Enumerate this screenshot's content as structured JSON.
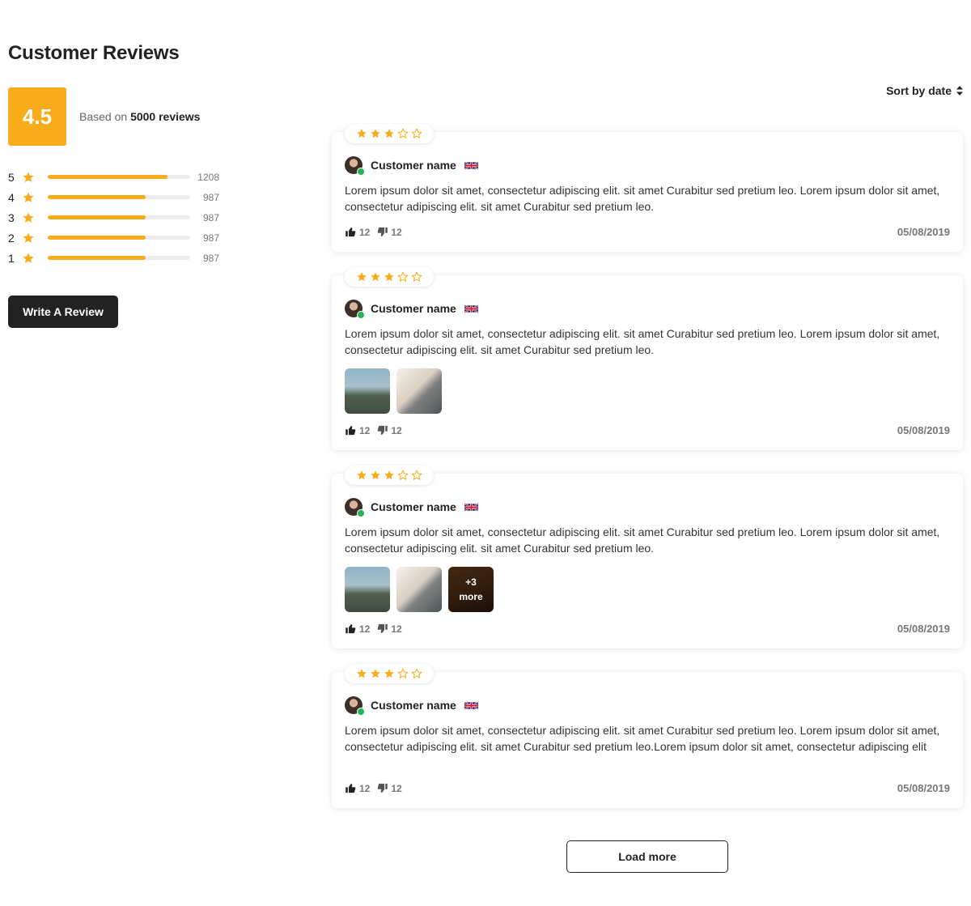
{
  "page": {
    "title": "Customer Reviews"
  },
  "summary": {
    "score": "4.5",
    "based_on_prefix": "Based on",
    "based_on_count": "5000 reviews",
    "distribution": [
      {
        "stars": "5",
        "count": "1208",
        "fraction": 0.84
      },
      {
        "stars": "4",
        "count": "987",
        "fraction": 0.69
      },
      {
        "stars": "3",
        "count": "987",
        "fraction": 0.69
      },
      {
        "stars": "2",
        "count": "987",
        "fraction": 0.69
      },
      {
        "stars": "1",
        "count": "987",
        "fraction": 0.69
      }
    ],
    "write_review_label": "Write A Review"
  },
  "sort": {
    "label": "Sort by date",
    "icon": "sort-icon"
  },
  "colors": {
    "accent": "#f9ac1a",
    "dark": "#222222",
    "verified": "#22b45a"
  },
  "reviews": [
    {
      "rating": 3,
      "customer": "Customer name",
      "flag": "uk-flag-icon",
      "text": "Lorem ipsum dolor sit amet, consectetur adipiscing elit. sit amet Curabitur sed pretium leo. Lorem ipsum dolor sit amet, consectetur adipiscing elit. sit amet Curabitur sed pretium leo.",
      "likes": "12",
      "dislikes": "12",
      "date": "05/08/2019",
      "images": []
    },
    {
      "rating": 3,
      "customer": "Customer name",
      "flag": "uk-flag-icon",
      "text": "Lorem ipsum dolor sit amet, consectetur adipiscing elit. sit amet Curabitur sed pretium leo. Lorem ipsum dolor sit amet, consectetur adipiscing elit. sit amet Curabitur sed pretium leo.",
      "likes": "12",
      "dislikes": "12",
      "date": "05/08/2019",
      "images": [
        "backpack-photo",
        "backpack-photo"
      ]
    },
    {
      "rating": 3,
      "customer": "Customer name",
      "flag": "uk-flag-icon",
      "text": "Lorem ipsum dolor sit amet, consectetur adipiscing elit. sit amet Curabitur sed pretium leo. Lorem ipsum dolor sit amet, consectetur adipiscing elit. sit amet Curabitur sed pretium leo.",
      "likes": "12",
      "dislikes": "12",
      "date": "05/08/2019",
      "images": [
        "backpack-photo",
        "backpack-photo",
        "backpack-photo"
      ],
      "more_count": "+3",
      "more_label": "more"
    },
    {
      "rating": 3,
      "customer": "Customer name",
      "flag": "uk-flag-icon",
      "text": "Lorem ipsum dolor sit amet, consectetur adipiscing elit. sit amet Curabitur sed pretium leo. Lorem ipsum dolor sit amet, consectetur adipiscing elit. sit amet Curabitur sed pretium leo.Lorem ipsum dolor sit amet, consectetur adipiscing elit",
      "likes": "12",
      "dislikes": "12",
      "date": "05/08/2019",
      "images": []
    }
  ],
  "load_more_label": "Load more"
}
